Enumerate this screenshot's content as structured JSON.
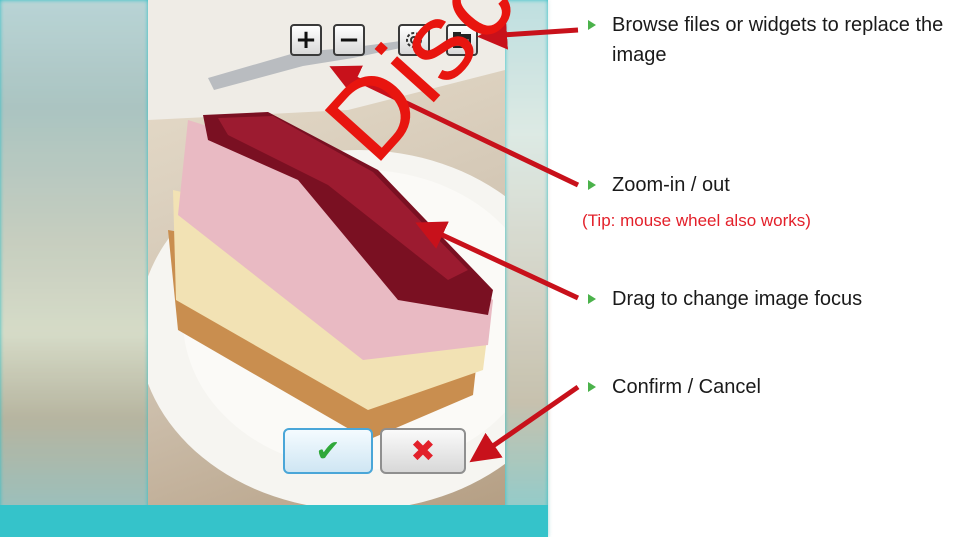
{
  "toolbar": {
    "zoom_in_label": "+",
    "zoom_out_label": "−",
    "settings_icon": "gear-icon",
    "browse_icon": "folder-icon"
  },
  "actions": {
    "confirm_label": "✔",
    "cancel_label": "✖"
  },
  "annotations": [
    {
      "line1": "Browse files or widgets to replace the",
      "line2": "image"
    },
    {
      "line1": "Zoom-in / out",
      "tip": "(Tip: mouse wheel also works)"
    },
    {
      "line1": "Drag to change image focus"
    },
    {
      "line1": "Confirm / Cancel"
    }
  ],
  "watermark": "Discontinued",
  "colors": {
    "frame": "#2bbfc6",
    "arrow": "#c8111b",
    "bullet": "#4bb24b",
    "tip": "#e3202a",
    "confirm": "#2fa83a",
    "cancel": "#e2202a"
  }
}
